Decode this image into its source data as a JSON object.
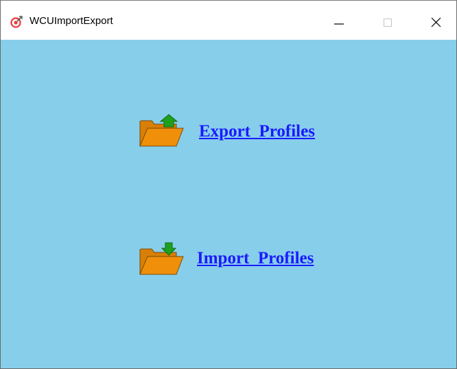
{
  "window": {
    "title": "WCUImportExport",
    "app_icon": "target-icon"
  },
  "caption_buttons": {
    "minimize": "minimize-icon",
    "maximize": "maximize-icon",
    "close": "close-icon"
  },
  "actions": {
    "export": {
      "label": "Export  Profiles",
      "icon": "folder-export-icon"
    },
    "import": {
      "label": "Import  Profiles",
      "icon": "folder-import-icon"
    }
  },
  "colors": {
    "client_background": "#87ceeb",
    "link": "#1a1aff",
    "folder": "#f0900a",
    "arrow": "#1ea01e"
  }
}
